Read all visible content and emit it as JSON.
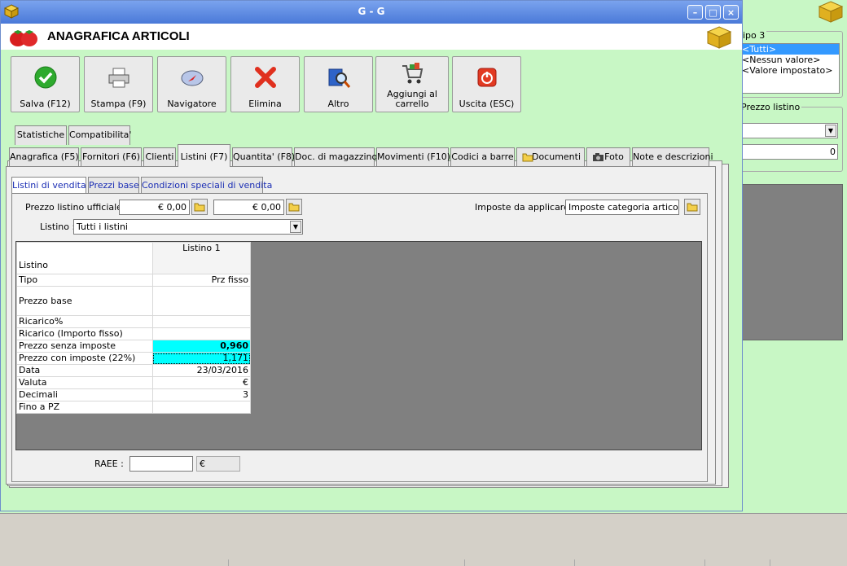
{
  "window": {
    "title": "G - G",
    "minimize": "–",
    "maximize": "□",
    "close": "×"
  },
  "header": {
    "title": "ANAGRAFICA ARTICOLI"
  },
  "toolbar": [
    {
      "label": "Salva (F12)",
      "icon": "check-icon"
    },
    {
      "label": "Stampa (F9)",
      "icon": "printer-icon"
    },
    {
      "label": "Navigatore",
      "icon": "compass-icon"
    },
    {
      "label": "Elimina",
      "icon": "delete-x-icon"
    },
    {
      "label": "Altro",
      "icon": "search-book-icon"
    },
    {
      "label": "Aggiungi al carrello",
      "icon": "cart-icon"
    },
    {
      "label": "Uscita (ESC)",
      "icon": "power-icon"
    }
  ],
  "tabs_row1": [
    "Statistiche",
    "Compatibilita'"
  ],
  "tabs_row2": [
    "Anagrafica (F5)",
    "Fornitori (F6)",
    "Clienti",
    "Listini (F7)",
    "Quantita' (F8)",
    "Doc. di magazzino",
    "Movimenti (F10)",
    "Codici a barre",
    "Documenti",
    "Foto",
    "Note e descrizioni"
  ],
  "subtabs": [
    "Listini di vendita",
    "Prezzi base",
    "Condizioni speciali di vendita"
  ],
  "form": {
    "prezzo_label": "Prezzo listino ufficiale :",
    "prezzo_value1": "€ 0,00",
    "prezzo_value2": "€ 0,00",
    "imposte_label": "Imposte da applicare :",
    "imposte_value": "Imposte categoria articolo",
    "listino_label": "Listino :",
    "listino_value": "Tutti i listini",
    "raee_label": "RAEE :",
    "raee_value": "",
    "raee_currency": "€"
  },
  "grid": {
    "header": [
      "Listino",
      "Listino 1"
    ],
    "rows": [
      {
        "label": "Tipo",
        "value": "Prz fisso"
      },
      {
        "label": "Prezzo base",
        "value": ""
      },
      {
        "label": "Ricarico%",
        "value": ""
      },
      {
        "label": "Ricarico (Importo fisso)",
        "value": ""
      },
      {
        "label": "Prezzo senza imposte",
        "value": "0,960"
      },
      {
        "label": "Prezzo con imposte (22%)",
        "value": "1,171"
      },
      {
        "label": "Data",
        "value": "23/03/2016"
      },
      {
        "label": "Valuta",
        "value": "€"
      },
      {
        "label": "Decimali",
        "value": "3"
      },
      {
        "label": "Fino a PZ",
        "value": ""
      }
    ]
  },
  "background_panel": {
    "tipo_title": "ipo 3",
    "tipo_items": [
      "<Tutti>",
      "<Nessun valore>",
      "<Valore impostato>"
    ],
    "prezzo_title": "Prezzo listino",
    "prezzo_value": "0"
  },
  "colors": {
    "accent": "#c8f7c5",
    "highlight": "#00ffff",
    "titlebar": "#4a79d8"
  }
}
